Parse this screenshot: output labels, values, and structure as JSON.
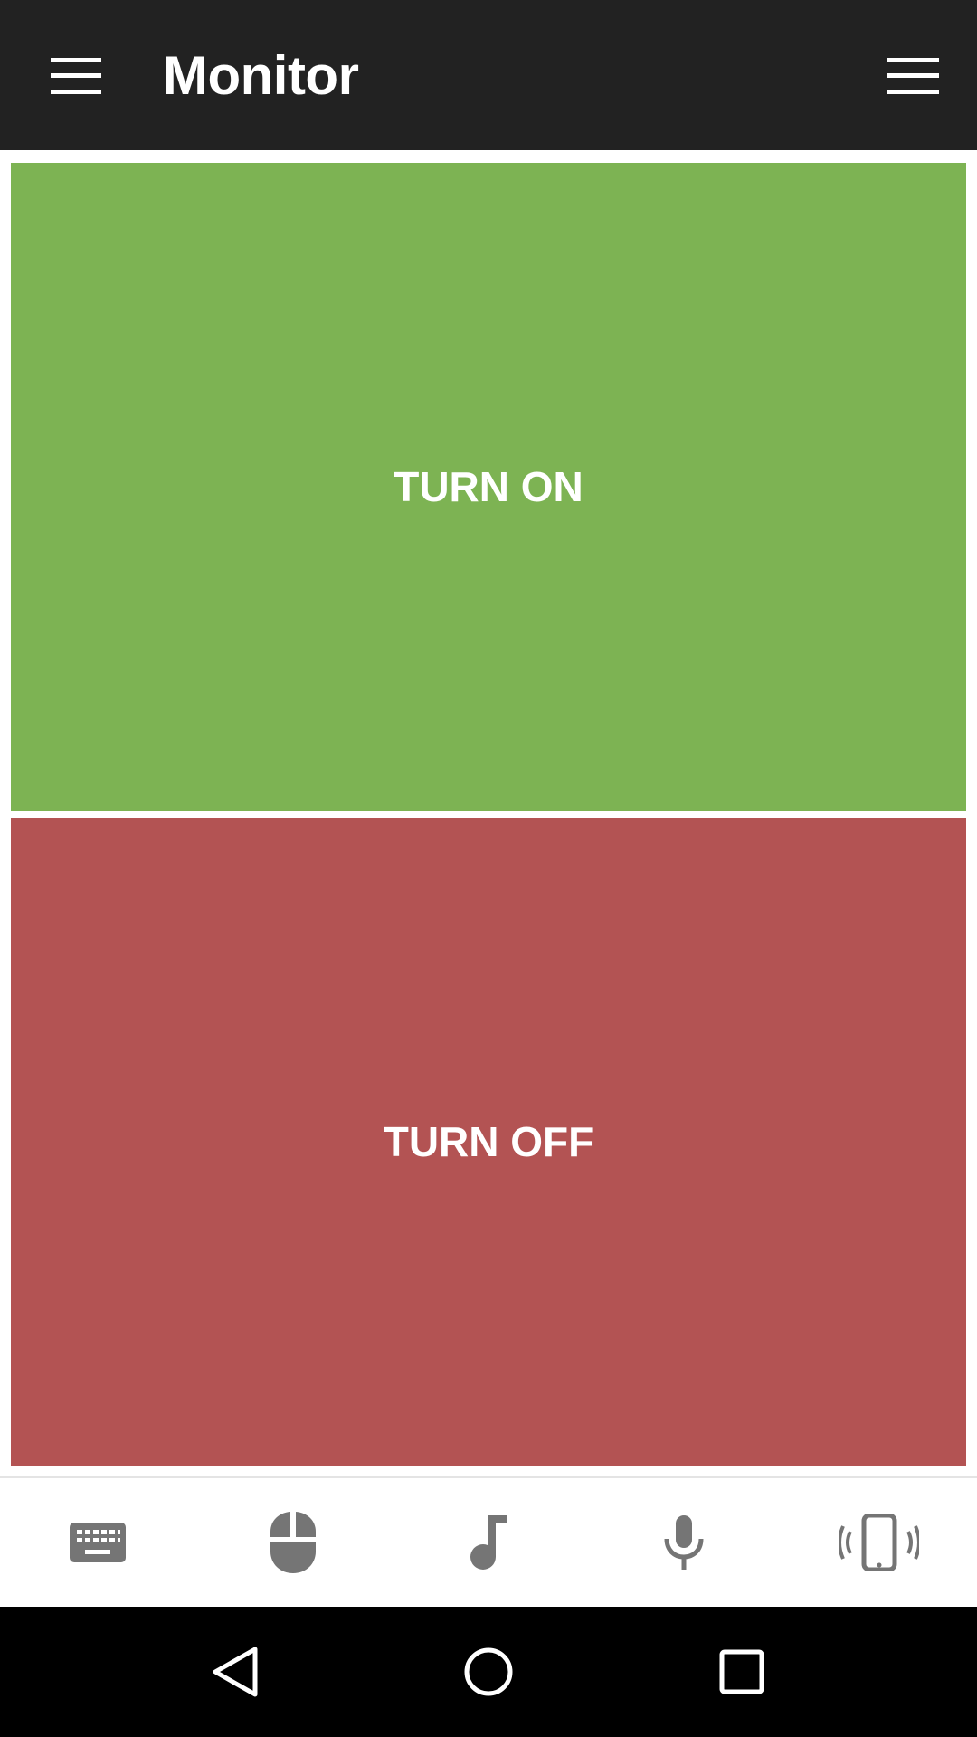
{
  "toolbar": {
    "title": "Monitor",
    "menu_icon": "hamburger-menu-icon",
    "overflow_icon": "overflow-menu-icon"
  },
  "buttons": {
    "on_label": "TURN ON",
    "off_label": "TURN OFF"
  },
  "bottom_nav": {
    "items": [
      {
        "icon": "keyboard-icon"
      },
      {
        "icon": "mouse-icon"
      },
      {
        "icon": "music-note-icon"
      },
      {
        "icon": "microphone-icon"
      },
      {
        "icon": "phone-vibrate-icon"
      }
    ]
  },
  "system_nav": {
    "back_icon": "back-triangle-icon",
    "home_icon": "home-circle-icon",
    "recents_icon": "recents-square-icon"
  },
  "colors": {
    "toolbar_bg": "#222222",
    "on_bg": "#7db353",
    "off_bg": "#b35353",
    "nav_icon": "#757575",
    "system_bar": "#000000"
  }
}
